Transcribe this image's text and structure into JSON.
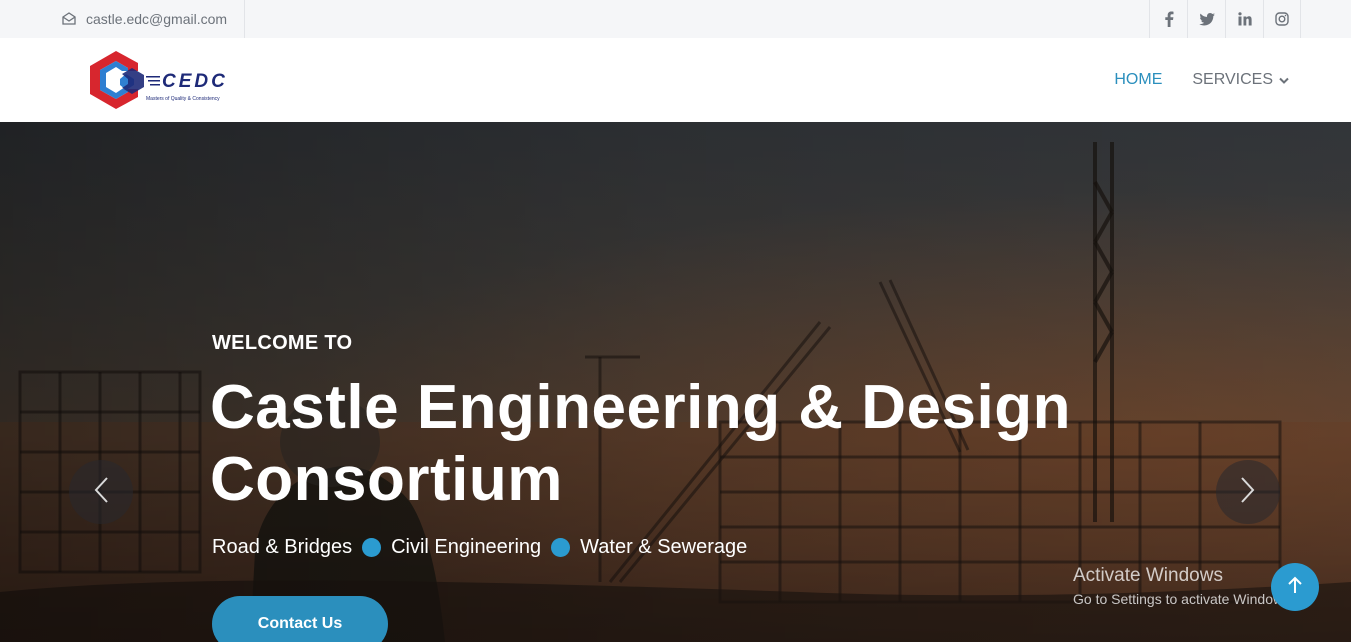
{
  "topbar": {
    "email": "castle.edc@gmail.com",
    "email_icon": "envelope-icon",
    "social": [
      {
        "name": "facebook",
        "glyph": "f"
      },
      {
        "name": "twitter",
        "glyph": "t"
      },
      {
        "name": "linkedin",
        "glyph": "in"
      },
      {
        "name": "instagram",
        "glyph": "ig"
      }
    ]
  },
  "header": {
    "logo_text": "CEDC",
    "logo_tagline": "Masters of Quality & Consistency",
    "nav": {
      "home": "HOME",
      "services": "SERVICES"
    }
  },
  "hero": {
    "welcome": "WELCOME TO",
    "title": "Castle Engineering & Design Consortium",
    "services": [
      "Road & Bridges",
      "Civil Engineering",
      "Water & Sewerage"
    ],
    "cta": "Contact Us"
  },
  "os_overlay": {
    "line1": "Activate Windows",
    "line2": "Go to Settings to activate Windows."
  },
  "colors": {
    "accent": "#2b8fbd",
    "dot": "#2b9bd0",
    "logo_red": "#d7262e",
    "logo_blue": "#2f7fd1",
    "logo_navy": "#1e2a78"
  }
}
